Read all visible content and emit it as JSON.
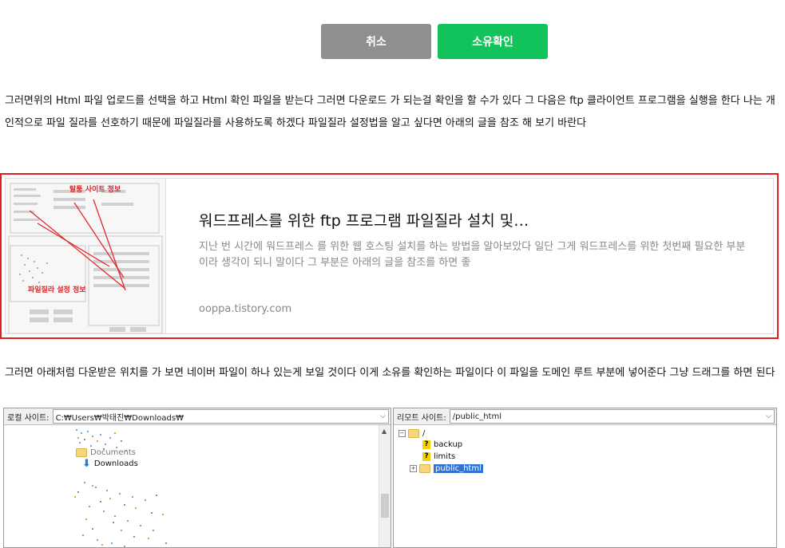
{
  "buttons": {
    "cancel": "취소",
    "confirm": "소유확인"
  },
  "paragraphs": {
    "p1": "그러면위의 Html 파일 업로드를 선택을 하고 Html 확인 파일을 받는다 그러면 다운로드 가 되는걸 확인을 할 수가 있다 그 다음은 ftp 클라이언트 프로그램을 실행을 한다 나는 개인적으로 파일 질라를 선호하기 때문에 파일질라를 사용하도록 하겠다 파일질라 설정법을 알고 싶다면 아래의 글을 참조 해 보기 바란다",
    "p2": "그러면 아래처럼 다운받은 위치를 가 보면 네이버 파일이 하나 있는게 보일 것이다 이게 소유를 확인하는 파일이다 이 파일을 도메인 루트 부분에 넣어준다 그냥 드래그를 하면 된다"
  },
  "link_card": {
    "title": "워드프레스를 위한 ftp 프로그램 파일질라 설치 및…",
    "description": "지난 번 시간에 워드프레스 를 위한 웹 호스팅 설치를 하는 방법을 알아보았다 일단 그게 워드프레스를 위한 첫번째 필요한 부분이라 생각이 되니 말이다 그 부분은 아래의 글을 참조를 하면 좋",
    "url": "ooppa.tistory.com",
    "thumb_caption_top": "탈퉁 사이트 정보",
    "thumb_caption_bottom": "파일질라 설정 정보"
  },
  "ftp": {
    "local": {
      "label": "로컬 사이트:",
      "path": "C:₩Users₩박태진₩Downloads₩",
      "tree": [
        "Documents",
        "Downloads"
      ]
    },
    "remote": {
      "label": "리모트 사이트:",
      "path": "/public_html",
      "tree": [
        "/",
        "backup",
        "limits",
        "public_html"
      ]
    }
  }
}
